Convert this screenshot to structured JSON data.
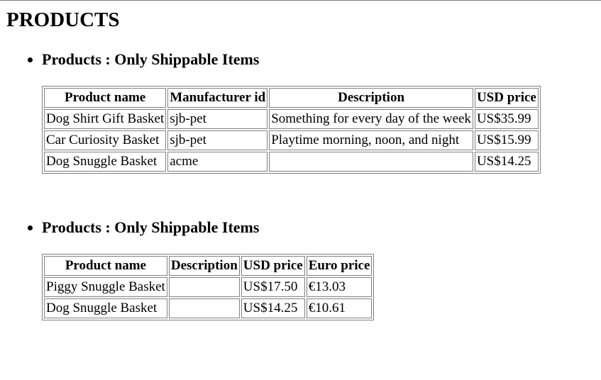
{
  "page": {
    "title": "PRODUCTS"
  },
  "sections": [
    {
      "heading": "Products : Only Shippable Items",
      "columns": [
        "Product name",
        "Manufacturer id",
        "Description",
        "USD price"
      ],
      "rows": [
        [
          "Dog Shirt Gift Basket",
          "sjb-pet",
          "Something for every day of the week",
          "US$35.99"
        ],
        [
          "Car Curiosity Basket",
          "sjb-pet",
          "Playtime morning, noon, and night",
          "US$15.99"
        ],
        [
          "Dog Snuggle Basket",
          "acme",
          "",
          "US$14.25"
        ]
      ]
    },
    {
      "heading": "Products : Only Shippable Items",
      "columns": [
        "Product name",
        "Description",
        "USD price",
        "Euro price"
      ],
      "rows": [
        [
          "Piggy Snuggle Basket",
          "",
          "US$17.50",
          "€13.03"
        ],
        [
          "Dog Snuggle Basket",
          "",
          "US$14.25",
          "€10.61"
        ]
      ]
    }
  ]
}
